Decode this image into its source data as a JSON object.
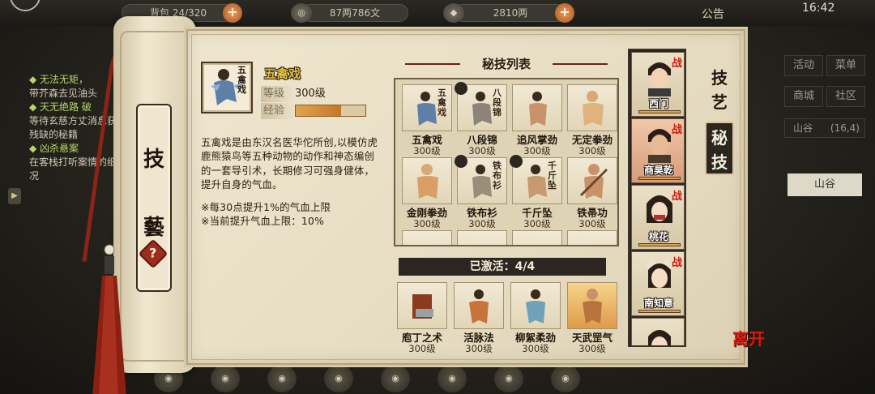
{
  "topbar": {
    "bag_label": "背包",
    "bag_count": "24/320",
    "copper": "87两786文",
    "silver": "2810两",
    "notice": "公告",
    "time": "16:42"
  },
  "quests": [
    {
      "title": "无法无矩，",
      "body": "带芥森去见油头"
    },
    {
      "title": "天无绝路 破",
      "body": "等待玄慈方丈消息获得残缺的秘籍"
    },
    {
      "title": "凶杀悬案",
      "body": "在客栈打听案情的细情况"
    }
  ],
  "right_menu": {
    "activity": "活动",
    "menu": "菜单",
    "shop": "商城",
    "community": "社区",
    "location": "山谷",
    "location_coord": "(16,4)",
    "field": "山谷"
  },
  "scroll_title": {
    "char1": "技",
    "char2": "藝",
    "help": "?"
  },
  "selected_skill": {
    "name": "五禽戏",
    "level_label": "等级",
    "level_value": "300级",
    "exp_label": "经验",
    "exp_fraction": 0.65,
    "badge_text": "五禽戏",
    "description": "五禽戏是由东汉名医华佗所创,以模仿虎鹿熊猿鸟等五种动物的动作和神态编创的一套导引术，长期修习可强身健体，提升自身的气血。",
    "note1": "※每30点提升1%的气血上限",
    "note2": "※当前提升气血上限：10%"
  },
  "skill_list": {
    "title": "秘技列表",
    "items": [
      {
        "name": "五禽戏",
        "level": "300级",
        "glyph": "五禽戏"
      },
      {
        "name": "八段锦",
        "level": "300级",
        "glyph": "八段锦"
      },
      {
        "name": "追风掌劲",
        "level": "300级",
        "glyph": ""
      },
      {
        "name": "无定拳劲",
        "level": "300级",
        "glyph": ""
      },
      {
        "name": "金刚拳劲",
        "level": "300级",
        "glyph": ""
      },
      {
        "name": "铁布衫",
        "level": "300级",
        "glyph": "铁布衫"
      },
      {
        "name": "千斤坠",
        "level": "300级",
        "glyph": "千斤坠"
      },
      {
        "name": "铁帚功",
        "level": "300级",
        "glyph": ""
      }
    ]
  },
  "active": {
    "title": "已激活：4/4",
    "items": [
      {
        "name": "庖丁之术",
        "level": "300级"
      },
      {
        "name": "活脉法",
        "level": "300级"
      },
      {
        "name": "柳絮柔劲",
        "level": "300级"
      },
      {
        "name": "天武罡气",
        "level": "300级"
      }
    ]
  },
  "characters": [
    {
      "name": "西门",
      "tag": "战"
    },
    {
      "name": "商昊乾",
      "tag": "战"
    },
    {
      "name": "桃花",
      "tag": "战"
    },
    {
      "name": "南知意",
      "tag": "战"
    }
  ],
  "tabs": {
    "skills": "技艺",
    "secret": "秘技"
  },
  "leave": "离开",
  "colors": {
    "accent_red": "#c81d10",
    "exp_orange": "#e0a44e",
    "name_gold": "#e2c33a",
    "ink": "#2b2620"
  }
}
